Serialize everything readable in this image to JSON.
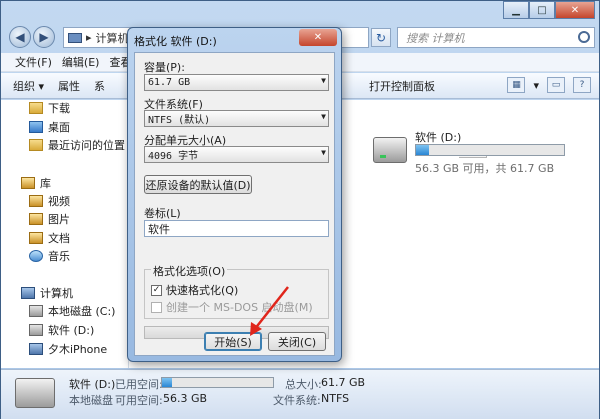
{
  "explorer": {
    "address": "计算机",
    "search_placeholder": "搜索 计算机",
    "menu": [
      "文件(F)",
      "编辑(E)",
      "查看(V)"
    ],
    "toolbar": {
      "organize": "组织 ▾",
      "properties": "属性",
      "partial": "系",
      "control_panel": "打开控制面板"
    },
    "nav": {
      "favorites": [
        {
          "label": "下载",
          "icon": "download-folder"
        },
        {
          "label": "桌面",
          "icon": "desktop-folder"
        },
        {
          "label": "最近访问的位置",
          "icon": "recent-places"
        }
      ],
      "library": "库",
      "libraries": [
        {
          "label": "视频",
          "icon": "video-library"
        },
        {
          "label": "图片",
          "icon": "pictures-library"
        },
        {
          "label": "文档",
          "icon": "documents-library"
        },
        {
          "label": "音乐",
          "icon": "music-library"
        }
      ],
      "computer": "计算机",
      "drives": [
        {
          "label": "本地磁盘 (C:)",
          "icon": "drive"
        },
        {
          "label": "软件 (D:)",
          "icon": "drive"
        },
        {
          "label": "夕木iPhone",
          "icon": "phone"
        }
      ]
    },
    "drive_tile": {
      "name": "软件 (D:)",
      "free_text": "56.3 GB 可用，共 61.7 GB",
      "used_fraction": 0.09
    },
    "status": {
      "name": "软件 (D:)",
      "used_label": "已用空间:",
      "used_fraction": 0.09,
      "type": "本地磁盘",
      "free_label": "可用空间:",
      "free_value": "56.3 GB",
      "total_label": "总大小:",
      "total_value": "61.7 GB",
      "fs_label": "文件系统:",
      "fs_value": "NTFS"
    }
  },
  "dialog": {
    "title": "格式化 软件 (D:)",
    "capacity_label": "容量(P):",
    "capacity_value": "61.7 GB",
    "filesystem_label": "文件系统(F)",
    "filesystem_value": "NTFS (默认)",
    "allocation_label": "分配单元大小(A)",
    "allocation_value": "4096 字节",
    "restore_button": "还原设备的默认值(D)",
    "volume_label": "卷标(L)",
    "volume_value": "软件",
    "options_label": "格式化选项(O)",
    "quick_format": "快速格式化(Q)",
    "quick_format_checked": true,
    "msdos_disk": "创建一个 MS-DOS 启动盘(M)",
    "progress_fraction": 0,
    "start_button": "开始(S)",
    "close_button": "关闭(C)"
  },
  "colors": {
    "annotation_arrow": "#e0251b",
    "titlebar": "#bcd4ef",
    "drive_fill": "#2a86d4"
  }
}
